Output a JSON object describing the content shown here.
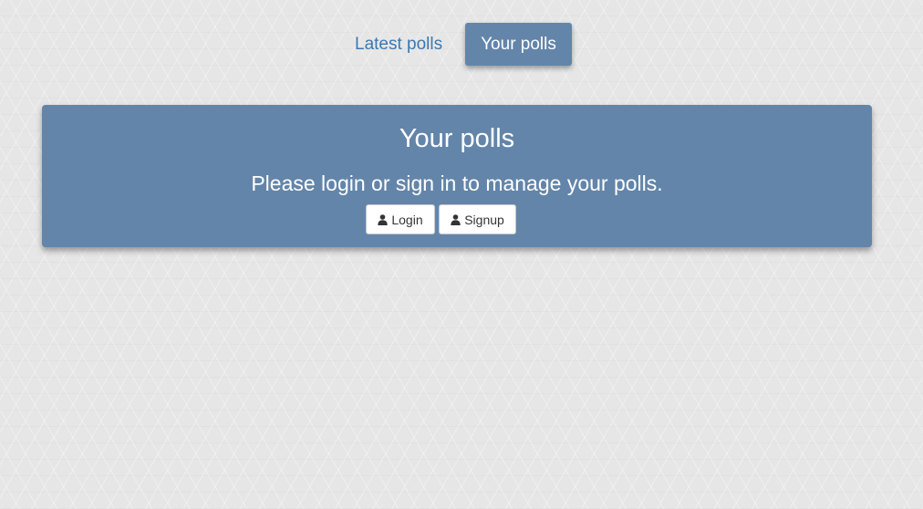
{
  "nav": {
    "latest_label": "Latest polls",
    "yours_label": "Your polls"
  },
  "panel": {
    "title": "Your polls",
    "message": "Please login or sign in to manage your polls.",
    "login_label": "Login",
    "signup_label": "Signup",
    "button_icon": "user-icon"
  },
  "colors": {
    "accent": "#6385aa",
    "link": "#3a78b0",
    "background": "#e6e6e6"
  }
}
